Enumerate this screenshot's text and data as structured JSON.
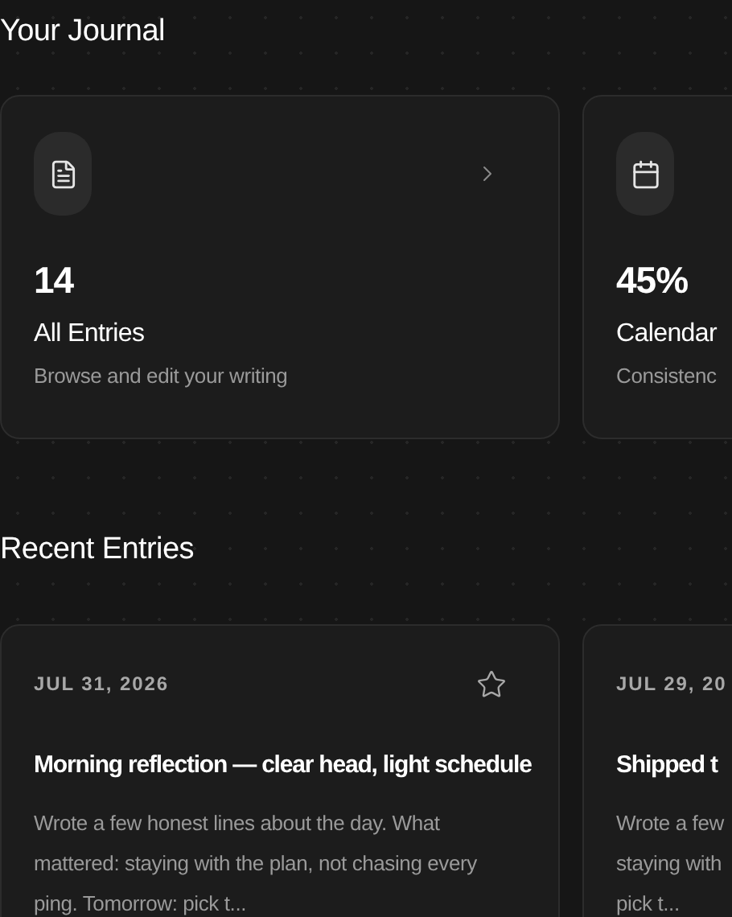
{
  "journal": {
    "title": "Your Journal",
    "cards": [
      {
        "kind": "document",
        "value": "14",
        "label": "All Entries",
        "description": "Browse and edit your writing",
        "chevron": true
      },
      {
        "kind": "calendar",
        "value": "45%",
        "label": "Calendar",
        "description": "Consistenc",
        "chevron": false
      }
    ]
  },
  "recent": {
    "title": "Recent Entries",
    "entries": [
      {
        "date": "JUL 31, 2026",
        "title": "Morning reflection — clear head, light schedule",
        "excerpt": "Wrote a few honest lines about the day. What mattered: staying with the plan, not chasing every ping. Tomorrow: pick t...",
        "starred": false
      },
      {
        "date": "JUL 29, 20",
        "title": "Shipped t",
        "excerpt_lines": [
          "Wrote a few",
          "staying with",
          "pick t..."
        ]
      }
    ]
  }
}
